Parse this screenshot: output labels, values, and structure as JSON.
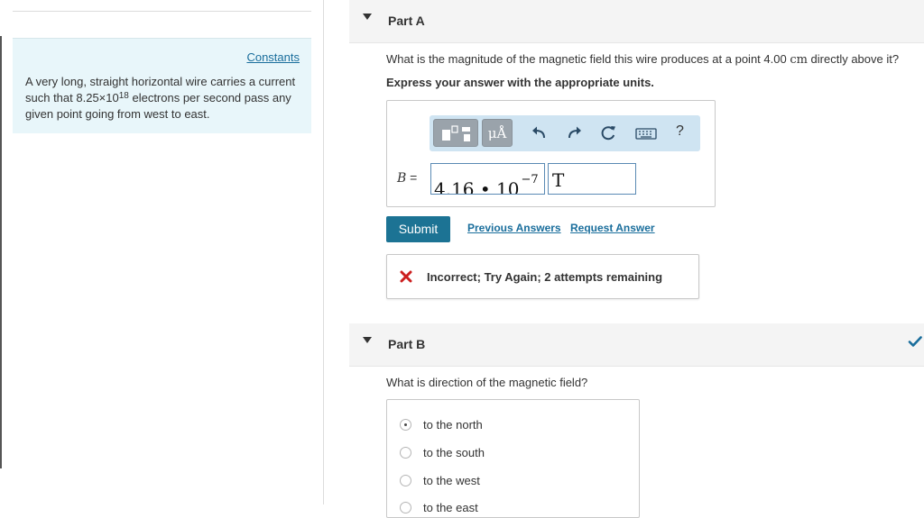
{
  "left_panel": {
    "constants_link": "Constants",
    "problem": {
      "prefix": "A very long, straight horizontal wire carries a current such that 8.25×10",
      "exponent": "18",
      "suffix": " electrons per second pass any given point going from west to east."
    }
  },
  "part_a": {
    "title": "Part A",
    "question_before": "What is the magnitude of the magnetic field this wire produces at a point 4.00 ",
    "question_unit": "cm",
    "question_after": " directly above it?",
    "instruction": "Express your answer with the appropriate units.",
    "toolbar": {
      "units_label": "μÅ",
      "help_label": "?"
    },
    "answer_label": "B",
    "answer_equals": " =",
    "answer_mantissa": "4.16 • 10",
    "answer_exponent": "−7",
    "answer_unit": "T",
    "submit_label": "Submit",
    "previous_answers": "Previous Answers",
    "request_answer": "Request Answer",
    "feedback": "Incorrect; Try Again; 2 attempts remaining",
    "colors": {
      "submit": "#1c7394",
      "error": "#cc1f1f",
      "link": "#1a6e9c"
    }
  },
  "part_b": {
    "title": "Part B",
    "question": "What is direction of the magnetic field?",
    "options": [
      "to the north",
      "to the south",
      "to the west",
      "to the east"
    ],
    "selected_option": "to the north",
    "colors": {
      "check": "#1a6e9c"
    }
  }
}
